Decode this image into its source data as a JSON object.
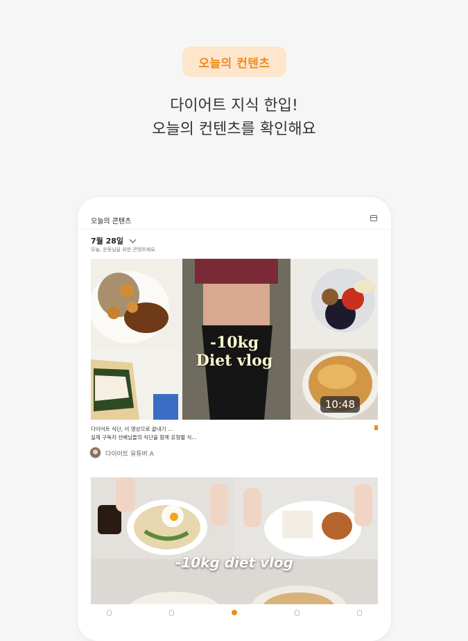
{
  "promo": {
    "badge": "오늘의 컨텐츠",
    "headline_line1": "다이어트 지식 한입!",
    "headline_line2": "오늘의 컨텐츠를 확인해요"
  },
  "app": {
    "header_title": "오늘의 콘텐츠",
    "date_label": "7월 28일",
    "date_subtitle": "오늘, 운동님을 위한 콘텐츠예요.",
    "cards": [
      {
        "thumbnail_title_line1": "-10kg",
        "thumbnail_title_line2": "Diet vlog",
        "duration": "10:48",
        "title_line1": "다이어트 식단, 이 영상으로 끝내기 ...",
        "title_line2": "실제 구독자 선배님들의 식단을 함께 유형별 식...",
        "channel": "다이어트 유튜버 A"
      },
      {
        "thumbnail_title": "-10kg diet vlog"
      }
    ],
    "colors": {
      "accent": "#f08a1c",
      "badge_bg": "#fde6cc",
      "page_bg": "#f6f6f6"
    }
  }
}
